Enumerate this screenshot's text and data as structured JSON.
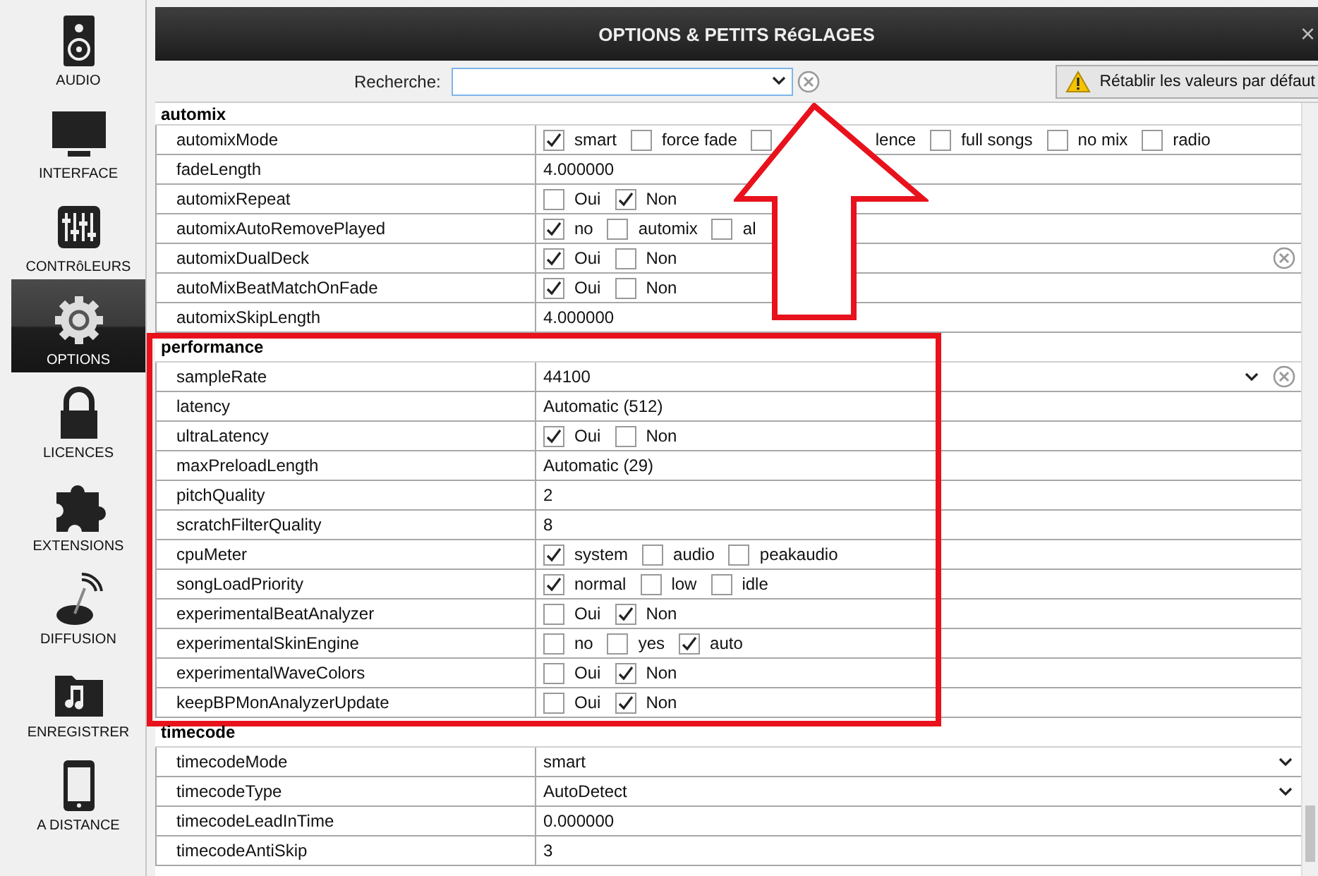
{
  "sidebar": {
    "items": [
      {
        "label": "AUDIO",
        "selected": false
      },
      {
        "label": "INTERFACE",
        "selected": false
      },
      {
        "label": "CONTRôLEURS",
        "selected": false
      },
      {
        "label": "OPTIONS",
        "selected": true
      },
      {
        "label": "LICENCES",
        "selected": false
      },
      {
        "label": "EXTENSIONS",
        "selected": false
      },
      {
        "label": "DIFFUSION",
        "selected": false
      },
      {
        "label": "ENREGISTRER",
        "selected": false
      },
      {
        "label": "A DISTANCE",
        "selected": false
      }
    ]
  },
  "window": {
    "title": "OPTIONS & PETITS RéGLAGES",
    "close": "×"
  },
  "search": {
    "label": "Recherche:"
  },
  "reset_button": "Rétablir les valeurs par défaut",
  "sections": [
    {
      "name": "automix",
      "rows": [
        {
          "name": "automixMode",
          "kind": "checks",
          "modified": false,
          "options": [
            {
              "label": "smart",
              "checked": true
            },
            {
              "label": "force fade",
              "checked": false
            },
            {
              "label": "lence",
              "checked": false,
              "partly_hidden": true
            },
            {
              "label": "full songs",
              "checked": false
            },
            {
              "label": "no mix",
              "checked": false
            },
            {
              "label": "radio",
              "checked": false
            }
          ]
        },
        {
          "name": "fadeLength",
          "kind": "value",
          "modified": false,
          "value": "4.000000"
        },
        {
          "name": "automixRepeat",
          "kind": "checks",
          "modified": false,
          "options": [
            {
              "label": "Oui",
              "checked": false
            },
            {
              "label": "Non",
              "checked": true
            }
          ]
        },
        {
          "name": "automixAutoRemovePlayed",
          "kind": "checks",
          "modified": false,
          "options": [
            {
              "label": "no",
              "checked": true
            },
            {
              "label": "automix",
              "checked": false
            },
            {
              "label": "al",
              "checked": false
            }
          ]
        },
        {
          "name": "automixDualDeck",
          "kind": "checks",
          "modified": true,
          "options": [
            {
              "label": "Oui",
              "checked": true
            },
            {
              "label": "Non",
              "checked": false
            }
          ]
        },
        {
          "name": "autoMixBeatMatchOnFade",
          "kind": "checks",
          "modified": false,
          "options": [
            {
              "label": "Oui",
              "checked": true
            },
            {
              "label": "Non",
              "checked": false
            }
          ]
        },
        {
          "name": "automixSkipLength",
          "kind": "value",
          "modified": false,
          "value": "4.000000"
        }
      ]
    },
    {
      "name": "performance",
      "highlighted": true,
      "rows": [
        {
          "name": "sampleRate",
          "kind": "select",
          "modified": true,
          "value": "44100"
        },
        {
          "name": "latency",
          "kind": "value",
          "modified": false,
          "value": "Automatic (512)"
        },
        {
          "name": "ultraLatency",
          "kind": "checks",
          "modified": false,
          "options": [
            {
              "label": "Oui",
              "checked": true
            },
            {
              "label": "Non",
              "checked": false
            }
          ]
        },
        {
          "name": "maxPreloadLength",
          "kind": "value",
          "modified": false,
          "value": "Automatic (29)"
        },
        {
          "name": "pitchQuality",
          "kind": "value",
          "modified": false,
          "value": "2"
        },
        {
          "name": "scratchFilterQuality",
          "kind": "value",
          "modified": false,
          "value": "8"
        },
        {
          "name": "cpuMeter",
          "kind": "checks",
          "modified": false,
          "options": [
            {
              "label": "system",
              "checked": true
            },
            {
              "label": "audio",
              "checked": false
            },
            {
              "label": "peakaudio",
              "checked": false
            }
          ]
        },
        {
          "name": "songLoadPriority",
          "kind": "checks",
          "modified": false,
          "options": [
            {
              "label": "normal",
              "checked": true
            },
            {
              "label": "low",
              "checked": false
            },
            {
              "label": "idle",
              "checked": false
            }
          ]
        },
        {
          "name": "experimentalBeatAnalyzer",
          "kind": "checks",
          "modified": false,
          "options": [
            {
              "label": "Oui",
              "checked": false
            },
            {
              "label": "Non",
              "checked": true
            }
          ]
        },
        {
          "name": "experimentalSkinEngine",
          "kind": "checks",
          "modified": false,
          "options": [
            {
              "label": "no",
              "checked": false
            },
            {
              "label": "yes",
              "checked": false
            },
            {
              "label": "auto",
              "checked": true
            }
          ]
        },
        {
          "name": "experimentalWaveColors",
          "kind": "checks",
          "modified": false,
          "options": [
            {
              "label": "Oui",
              "checked": false
            },
            {
              "label": "Non",
              "checked": true
            }
          ]
        },
        {
          "name": "keepBPMonAnalyzerUpdate",
          "kind": "checks",
          "modified": false,
          "options": [
            {
              "label": "Oui",
              "checked": false
            },
            {
              "label": "Non",
              "checked": true
            }
          ]
        }
      ]
    },
    {
      "name": "timecode",
      "highlighted": false,
      "rows": [
        {
          "name": "timecodeMode",
          "kind": "select",
          "modified": false,
          "value": "smart"
        },
        {
          "name": "timecodeType",
          "kind": "select",
          "modified": false,
          "value": "AutoDetect"
        },
        {
          "name": "timecodeLeadInTime",
          "kind": "value",
          "modified": false,
          "value": "0.000000"
        },
        {
          "name": "timecodeAntiSkip",
          "kind": "value",
          "modified": false,
          "value": "3"
        }
      ]
    }
  ],
  "annotation": {
    "arrow": true
  }
}
